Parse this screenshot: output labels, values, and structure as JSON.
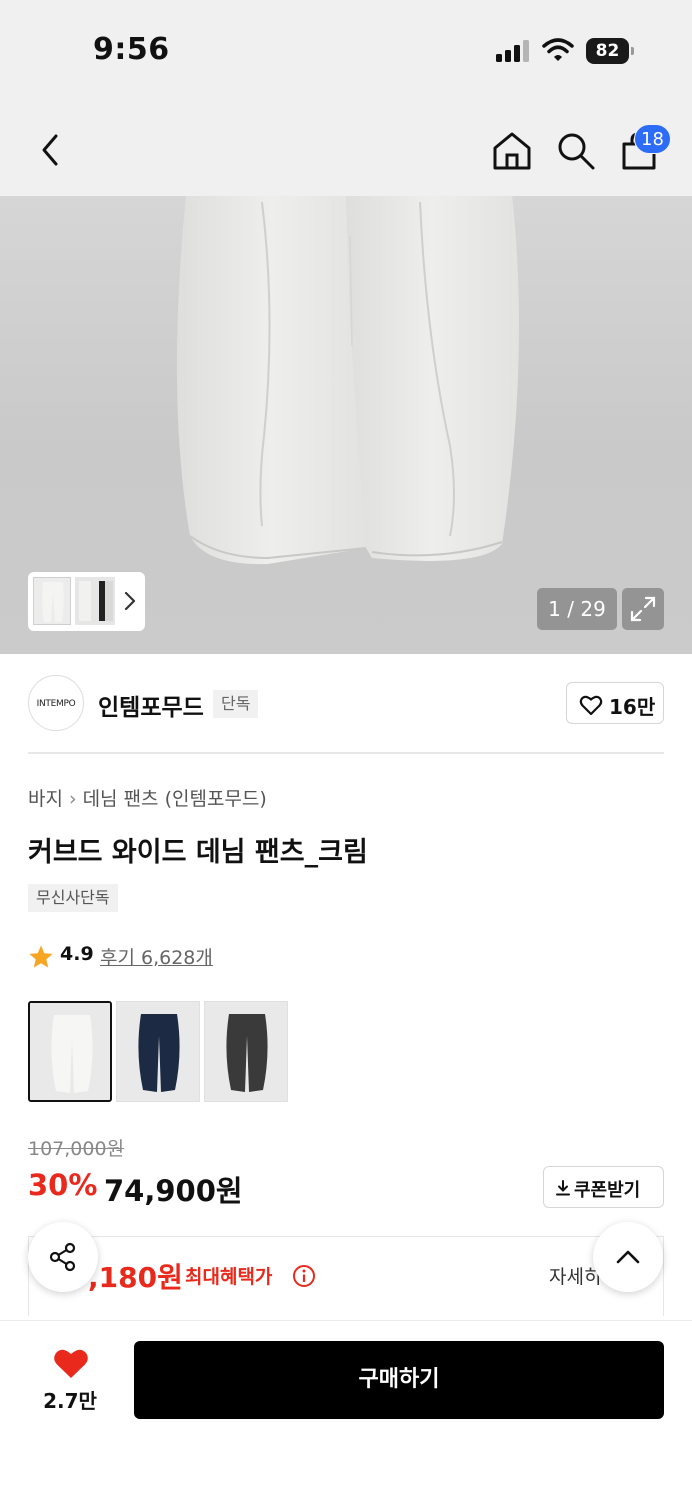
{
  "status_bar": {
    "time": "9:56",
    "battery": "82"
  },
  "nav": {
    "cart_count": "18"
  },
  "gallery": {
    "counter": "1 / 29"
  },
  "brand": {
    "logo_text": "INTEMPO",
    "name": "인템포무드",
    "tag": "단독",
    "likes": "16만"
  },
  "product": {
    "breadcrumb": [
      "바지",
      "데님 팬츠 (인템포무드)"
    ],
    "title": "커브드 와이드 데님 팬츠_크림",
    "exclusive_tag": "무신사단독",
    "rating": "4.9",
    "reviews_label": "후기 6,628개",
    "colors": [
      "cream",
      "navy",
      "charcoal"
    ],
    "colors_hex": {
      "cream": "#eeeeec",
      "navy": "#1d2a44",
      "charcoal": "#3a3a3a",
      "accent_red": "#e8291c",
      "badge_blue": "#2d6cf6"
    }
  },
  "price": {
    "original": "107,000원",
    "discount": "30%",
    "current": "74,900원",
    "coupon_label": "쿠폰받기"
  },
  "benefit": {
    "price": ",180원",
    "label": "최대혜택가",
    "detail": "자세히"
  },
  "bottom": {
    "wish_count": "2.7만",
    "buy_label": "구매하기"
  }
}
